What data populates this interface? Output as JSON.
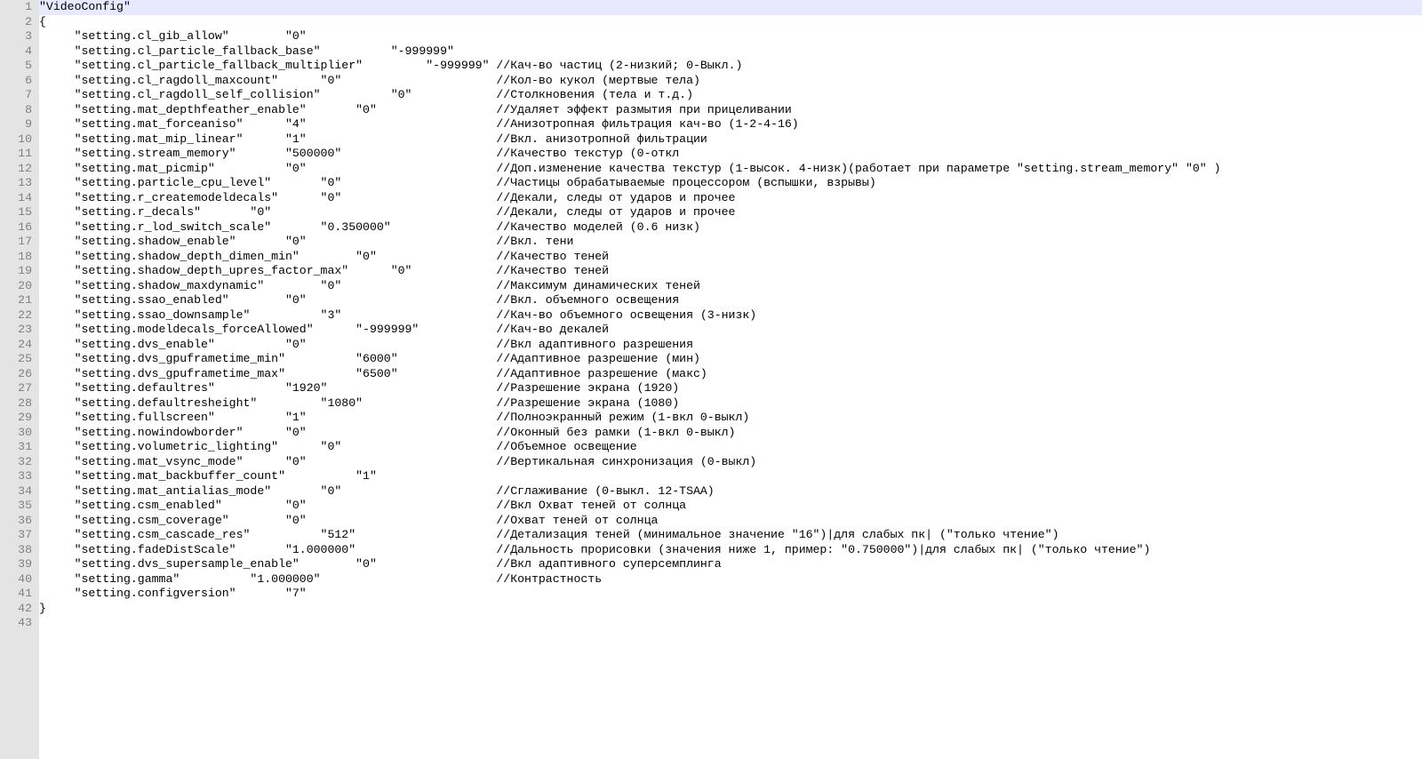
{
  "tab_size": 5,
  "comment_col": 65,
  "indented_keys": [
    "setting.cl_gib_allow",
    "setting.cl_particle_fallback_base",
    "setting.cl_particle_fallback_multiplier",
    "setting.cl_ragdoll_maxcount",
    "setting.cl_ragdoll_self_collision",
    "setting.mat_depthfeather_enable",
    "setting.mat_forceaniso",
    "setting.mat_mip_linear",
    "setting.stream_memory",
    "setting.mat_picmip",
    "setting.particle_cpu_level",
    "setting.r_createmodeldecals",
    "setting.r_decals",
    "setting.r_lod_switch_scale",
    "setting.shadow_enable",
    "setting.shadow_depth_dimen_min",
    "setting.shadow_depth_upres_factor_max",
    "setting.shadow_maxdynamic",
    "setting.ssao_enabled",
    "setting.ssao_downsample",
    "setting.modeldecals_forceAllowed",
    "setting.dvs_enable",
    "setting.dvs_gpuframetime_min",
    "setting.dvs_gpuframetime_max",
    "setting.defaultres",
    "setting.defaultresheight",
    "setting.fullscreen",
    "setting.nowindowborder",
    "setting.volumetric_lighting",
    "setting.mat_vsync_mode",
    "setting.mat_backbuffer_count",
    "setting.mat_antialias_mode",
    "setting.csm_enabled",
    "setting.csm_coverage",
    "setting.csm_cascade_res",
    "setting.fadeDistScale",
    "setting.dvs_supersample_enable",
    "setting.gamma",
    "setting.configversion"
  ],
  "lines": [
    {
      "raw": "\"VideoConfig\"",
      "hl": true
    },
    {
      "raw": "{"
    },
    {
      "key": "setting.cl_gib_allow",
      "value": "0"
    },
    {
      "key": "setting.cl_particle_fallback_base",
      "value": "-999999"
    },
    {
      "key": "setting.cl_particle_fallback_multiplier",
      "value": "-999999",
      "comment": "//Кач-во частиц (2-низкий; 0-Выкл.)"
    },
    {
      "key": "setting.cl_ragdoll_maxcount",
      "value": "0",
      "comment": "//Кол-во кукол (мертвые тела)"
    },
    {
      "key": "setting.cl_ragdoll_self_collision",
      "value": "0",
      "comment": "//Столкновения (тела и т.д.)"
    },
    {
      "key": "setting.mat_depthfeather_enable",
      "value": "0",
      "comment": "//Удаляет эффект размытия при прицеливании"
    },
    {
      "key": "setting.mat_forceaniso",
      "value": "4",
      "comment": "//Анизотропная фильтрация кач-во (1-2-4-16)"
    },
    {
      "key": "setting.mat_mip_linear",
      "value": "1",
      "comment": "//Вкл. анизотропной фильтрации"
    },
    {
      "key": "setting.stream_memory",
      "value": "500000",
      "comment": "//Качество текстур (0-откл"
    },
    {
      "key": "setting.mat_picmip",
      "value": "0",
      "comment": "//Доп.изменение качества текстур (1-высок. 4-низк)(работает при параметре \"setting.stream_memory\" \"0\" )"
    },
    {
      "key": "setting.particle_cpu_level",
      "value": "0",
      "comment": "//Частицы обрабатываемые процессором (вспышки, взрывы)"
    },
    {
      "key": "setting.r_createmodeldecals",
      "value": "0",
      "comment": "//Декали, следы от ударов и прочее"
    },
    {
      "key": "setting.r_decals",
      "value": "0",
      "comment": "//Декали, следы от ударов и прочее"
    },
    {
      "key": "setting.r_lod_switch_scale",
      "value": "0.350000",
      "comment": "//Качество моделей (0.6 низк)"
    },
    {
      "key": "setting.shadow_enable",
      "value": "0",
      "comment": "//Вкл. тени"
    },
    {
      "key": "setting.shadow_depth_dimen_min",
      "value": "0",
      "comment": "//Качество теней"
    },
    {
      "key": "setting.shadow_depth_upres_factor_max",
      "value": "0",
      "comment": "//Качество теней"
    },
    {
      "key": "setting.shadow_maxdynamic",
      "value": "0",
      "comment": "//Максимум динамических теней"
    },
    {
      "key": "setting.ssao_enabled",
      "value": "0",
      "comment": "//Вкл. объемного освещения"
    },
    {
      "key": "setting.ssao_downsample",
      "value": "3",
      "comment": "//Кач-во объемного освещения (3-низк)"
    },
    {
      "key": "setting.modeldecals_forceAllowed",
      "value": "-999999",
      "comment": "//Кач-во декалей"
    },
    {
      "key": "setting.dvs_enable",
      "value": "0",
      "comment": "//Вкл адаптивного разрешения"
    },
    {
      "key": "setting.dvs_gpuframetime_min",
      "value": "6000",
      "comment": "//Адаптивное разрешение (мин)"
    },
    {
      "key": "setting.dvs_gpuframetime_max",
      "value": "6500",
      "comment": "//Адаптивное разрешение (макс)"
    },
    {
      "key": "setting.defaultres",
      "value": "1920",
      "comment": "//Разрешение экрана (1920)"
    },
    {
      "key": "setting.defaultresheight",
      "value": "1080",
      "comment": "//Разрешение экрана (1080)"
    },
    {
      "key": "setting.fullscreen",
      "value": "1",
      "comment": "//Полноэкранный режим (1-вкл 0-выкл)"
    },
    {
      "key": "setting.nowindowborder",
      "value": "0",
      "comment": "//Оконный без рамки (1-вкл 0-выкл)"
    },
    {
      "key": "setting.volumetric_lighting",
      "value": "0",
      "comment": "//Объемное освещение"
    },
    {
      "key": "setting.mat_vsync_mode",
      "value": "0",
      "comment": "//Вертикальная синхронизация (0-выкл)"
    },
    {
      "key": "setting.mat_backbuffer_count",
      "value": "1"
    },
    {
      "key": "setting.mat_antialias_mode",
      "value": "0",
      "comment": "//Сглаживание (0-выкл. 12-TSAA)"
    },
    {
      "key": "setting.csm_enabled",
      "value": "0",
      "comment": "//Вкл Охват теней от солнца"
    },
    {
      "key": "setting.csm_coverage",
      "value": "0",
      "comment": "//Охват теней от солнца"
    },
    {
      "key": "setting.csm_cascade_res",
      "value": "512",
      "comment": "//Детализация теней (минимальное значение \"16\")|для слабых пк| (\"только чтение\")"
    },
    {
      "key": "setting.fadeDistScale",
      "value": "1.000000",
      "comment": "//Дальность прорисовки (значения ниже 1, пример: \"0.750000\")|для слабых пк| (\"только чтение\")"
    },
    {
      "key": "setting.dvs_supersample_enable",
      "value": "0",
      "comment": "//Вкл адаптивного суперсемплинга"
    },
    {
      "key": "setting.gamma",
      "value": "1.000000",
      "comment": "//Контрастность"
    },
    {
      "key": "setting.configversion",
      "value": "7"
    },
    {
      "raw": "}"
    },
    {
      "raw": ""
    }
  ]
}
